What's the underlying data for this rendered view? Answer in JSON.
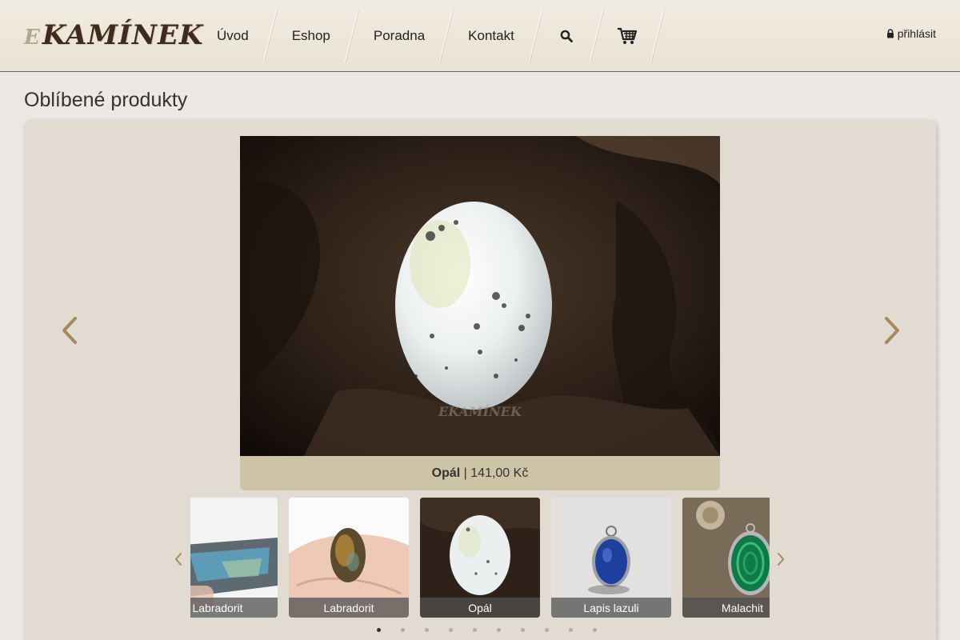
{
  "brand": {
    "logo_prefix": "E",
    "logo_main": "KAMÍNEK"
  },
  "nav": {
    "items": [
      {
        "label": "Úvod"
      },
      {
        "label": "Eshop"
      },
      {
        "label": "Poradna"
      },
      {
        "label": "Kontakt"
      }
    ],
    "search_icon": "search-icon",
    "cart_icon": "cart-icon"
  },
  "login": {
    "label": "přihlásit",
    "icon": "lock-icon"
  },
  "section": {
    "title": "Oblíbené produkty"
  },
  "slide": {
    "name": "Opál",
    "separator": " | ",
    "price": "141,00 Kč",
    "watermark": "EKAMÍNEK"
  },
  "thumbnails": [
    {
      "label": "Labradorit"
    },
    {
      "label": "Labradorit"
    },
    {
      "label": "Opál"
    },
    {
      "label": "Lapis lazuli"
    },
    {
      "label": "Malachit"
    }
  ],
  "pagination": {
    "count": 10,
    "active": 0
  },
  "colors": {
    "accent_arrow": "#a68a5e",
    "caption_bg": "#cdc3a6",
    "panel_bg": "#e2dbd1"
  }
}
